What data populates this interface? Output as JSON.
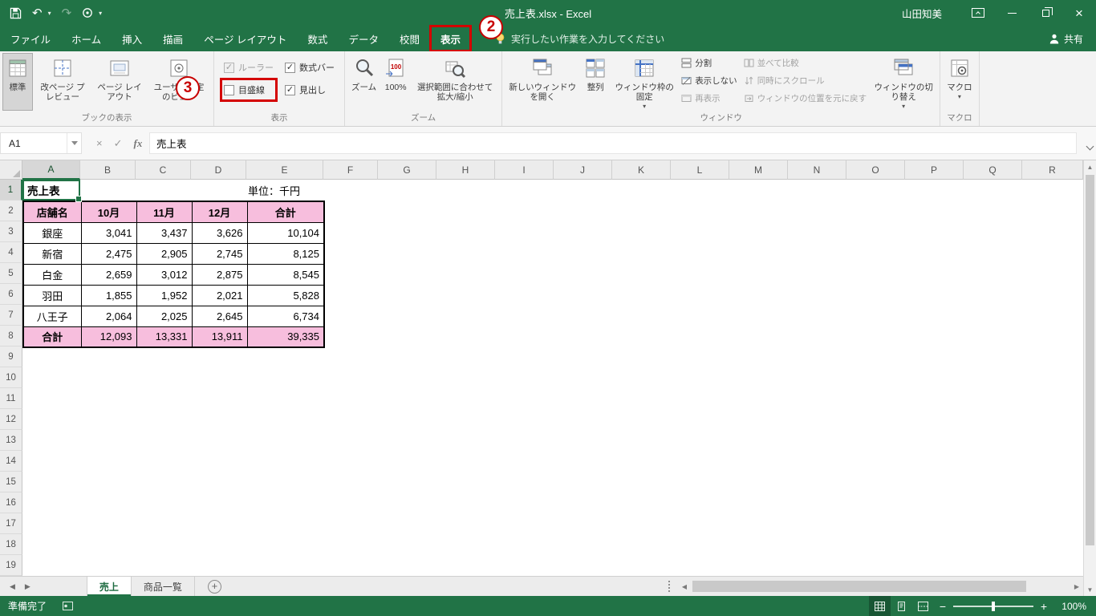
{
  "colors": {
    "excel_green": "#217346",
    "table_header_pink": "#f7bedd",
    "annotation_red": "#d40000"
  },
  "titlebar": {
    "title": "売上表.xlsx  -  Excel",
    "user": "山田知美"
  },
  "ribbon_tabs": {
    "items": [
      "ファイル",
      "ホーム",
      "挿入",
      "描画",
      "ページ レイアウト",
      "数式",
      "データ",
      "校閲",
      "表示"
    ],
    "active": "表示",
    "search_placeholder": "実行したい作業を入力してください",
    "share": "共有"
  },
  "ribbon": {
    "book_views": {
      "group_label": "ブックの表示",
      "normal": "標準",
      "page_break": "改ページ プレビュー",
      "page_layout": "ページ レイアウト",
      "custom_views": "ユーザー設定のビュー"
    },
    "show": {
      "group_label": "表示",
      "checkboxes": [
        {
          "label": "ルーラー",
          "checked": true,
          "disabled": true,
          "highlighted": false
        },
        {
          "label": "目盛線",
          "checked": false,
          "disabled": false,
          "highlighted": true
        },
        {
          "label": "数式バー",
          "checked": true,
          "disabled": false,
          "highlighted": false
        },
        {
          "label": "見出し",
          "checked": true,
          "disabled": false,
          "highlighted": false
        }
      ]
    },
    "zoom": {
      "group_label": "ズーム",
      "zoom": "ズーム",
      "hundred": "100%",
      "fit_selection": "選択範囲に合わせて拡大/縮小"
    },
    "window": {
      "group_label": "ウィンドウ",
      "new_window": "新しいウィンドウを開く",
      "arrange": "整列",
      "freeze": "ウィンドウ枠の固定",
      "split": "分割",
      "hide": "表示しない",
      "unhide": "再表示",
      "compare": "並べて比較",
      "sync_scroll": "同時にスクロール",
      "reset_position": "ウィンドウの位置を元に戻す",
      "switch": "ウィンドウの切り替え"
    },
    "macro": {
      "group_label": "マクロ",
      "button": "マクロ"
    }
  },
  "formula_bar": {
    "name_box": "A1",
    "fx": "fx",
    "value": "売上表"
  },
  "grid": {
    "columns": [
      "A",
      "B",
      "C",
      "D",
      "E",
      "F",
      "G",
      "H",
      "I",
      "J",
      "K",
      "L",
      "M",
      "N",
      "O",
      "P",
      "Q",
      "R"
    ],
    "row_count": 19,
    "selected_cell": "A1",
    "cells": {
      "A1": "売上表",
      "E1": "単位：千円"
    },
    "table": {
      "headers": [
        "店舗名",
        "10月",
        "11月",
        "12月",
        "合計"
      ],
      "rows": [
        [
          "銀座",
          "3,041",
          "3,437",
          "3,626",
          "10,104"
        ],
        [
          "新宿",
          "2,475",
          "2,905",
          "2,745",
          "8,125"
        ],
        [
          "白金",
          "2,659",
          "3,012",
          "2,875",
          "8,545"
        ],
        [
          "羽田",
          "1,855",
          "1,952",
          "2,021",
          "5,828"
        ],
        [
          "八王子",
          "2,064",
          "2,025",
          "2,645",
          "6,734"
        ]
      ],
      "total_row": [
        "合計",
        "12,093",
        "13,331",
        "13,911",
        "39,335"
      ]
    }
  },
  "sheet_tabs": {
    "tabs": [
      "売上",
      "商品一覧"
    ],
    "active": "売上"
  },
  "status_bar": {
    "ready": "準備完了",
    "zoom_level": "100%"
  },
  "annotations": {
    "step2": "2",
    "step3": "3"
  }
}
